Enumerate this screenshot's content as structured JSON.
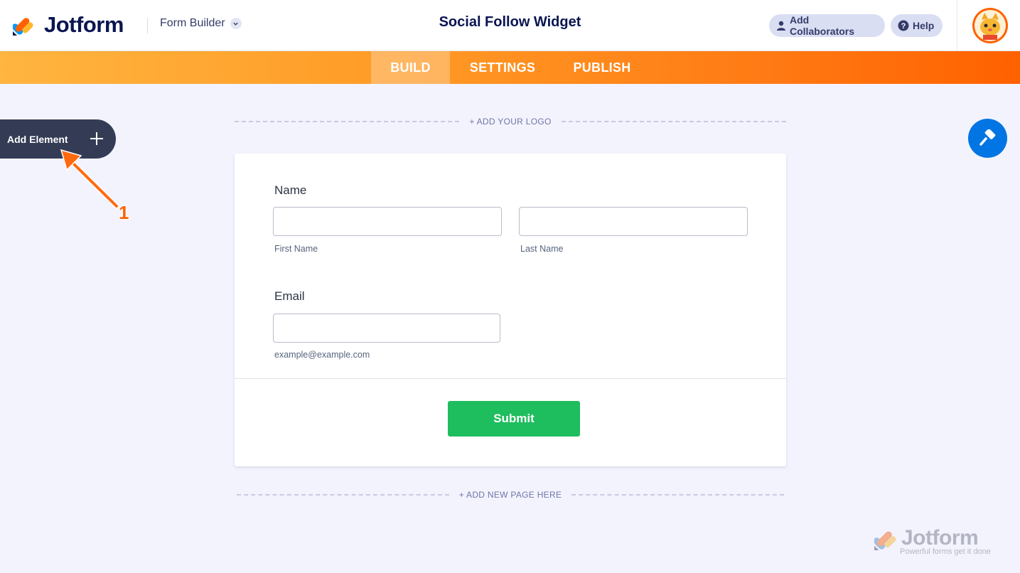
{
  "app": {
    "brand": "Jotform",
    "mode_label": "Form Builder",
    "form_title": "Social Follow Widget"
  },
  "header": {
    "collaborators_label": "Add Collaborators",
    "help_label": "Help"
  },
  "tabs": [
    {
      "label": "BUILD",
      "active": true
    },
    {
      "label": "SETTINGS",
      "active": false
    },
    {
      "label": "PUBLISH",
      "active": false
    }
  ],
  "sidebar": {
    "add_element_label": "Add Element"
  },
  "annotation": {
    "step_number": "1"
  },
  "form": {
    "add_logo_label": "+ ADD YOUR LOGO",
    "fields": {
      "name": {
        "label": "Name",
        "first_sublabel": "First Name",
        "last_sublabel": "Last Name",
        "first_value": "",
        "last_value": ""
      },
      "email": {
        "label": "Email",
        "sublabel": "example@example.com",
        "value": ""
      }
    },
    "submit_label": "Submit",
    "add_page_label": "+ ADD NEW PAGE HERE"
  },
  "watermark": {
    "brand": "Jotform",
    "tagline": "Powerful forms get it done"
  },
  "colors": {
    "brand_navy": "#0a1551",
    "tab_gradient_start": "#ffb540",
    "tab_gradient_end": "#ff6100",
    "submit_green": "#1ebd5e",
    "designer_blue": "#0075e3",
    "add_element_bg": "#343c55",
    "annotation_orange": "#ff6100"
  }
}
